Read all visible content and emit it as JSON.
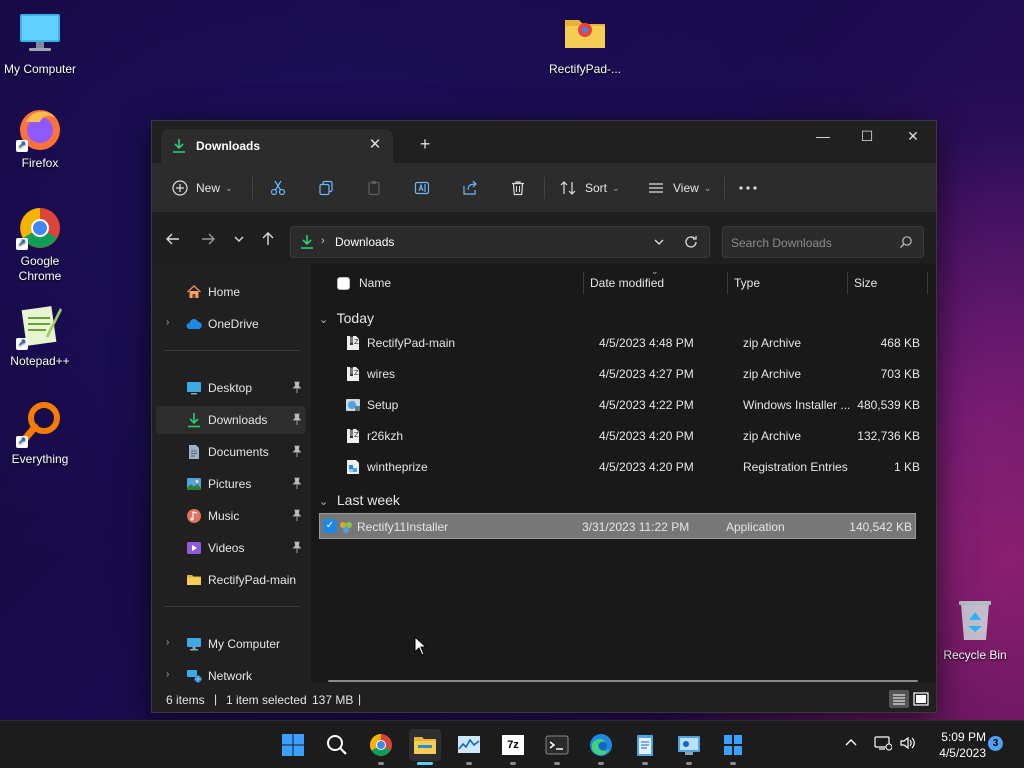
{
  "desktop": {
    "icons": [
      {
        "label": "My Computer"
      },
      {
        "label": "RectifyPad-..."
      },
      {
        "label": "Firefox"
      },
      {
        "label": "Google Chrome"
      },
      {
        "label": "Notepad++"
      },
      {
        "label": "Everything"
      },
      {
        "label": "Recycle Bin"
      }
    ]
  },
  "window": {
    "tab_title": "Downloads",
    "toolbar": {
      "new_label": "New",
      "sort_label": "Sort",
      "view_label": "View"
    },
    "address": {
      "crumb": "Downloads"
    },
    "search": {
      "placeholder": "Search Downloads"
    },
    "sidebar": {
      "items": [
        {
          "label": "Home"
        },
        {
          "label": "OneDrive"
        },
        {
          "label": "Desktop"
        },
        {
          "label": "Downloads"
        },
        {
          "label": "Documents"
        },
        {
          "label": "Pictures"
        },
        {
          "label": "Music"
        },
        {
          "label": "Videos"
        },
        {
          "label": "RectifyPad-main"
        },
        {
          "label": "My Computer"
        },
        {
          "label": "Network"
        }
      ]
    },
    "columns": {
      "name": "Name",
      "date": "Date modified",
      "type": "Type",
      "size": "Size"
    },
    "groups": [
      {
        "label": "Today"
      },
      {
        "label": "Last week"
      }
    ],
    "files": [
      {
        "name": "RectifyPad-main",
        "date": "4/5/2023 4:48 PM",
        "type": "zip Archive",
        "size": "468 KB"
      },
      {
        "name": "wires",
        "date": "4/5/2023 4:27 PM",
        "type": "zip Archive",
        "size": "703 KB"
      },
      {
        "name": "Setup",
        "date": "4/5/2023 4:22 PM",
        "type": "Windows Installer ...",
        "size": "480,539 KB"
      },
      {
        "name": "r26kzh",
        "date": "4/5/2023 4:20 PM",
        "type": "zip Archive",
        "size": "132,736 KB"
      },
      {
        "name": "wintheprize",
        "date": "4/5/2023 4:20 PM",
        "type": "Registration Entries",
        "size": "1 KB"
      },
      {
        "name": "Rectify11Installer",
        "date": "3/31/2023 11:22 PM",
        "type": "Application",
        "size": "140,542 KB"
      }
    ],
    "status": {
      "items": "6 items",
      "selected": "1 item selected",
      "size": "137 MB",
      "sep": "|"
    }
  },
  "taskbar": {
    "time": "5:09 PM",
    "date": "4/5/2023",
    "notifications": "3",
    "app_7z": "7z"
  },
  "colors": {
    "accent": "#60cdff",
    "folder": "#f4c84a",
    "download_green": "#2ecc71"
  }
}
